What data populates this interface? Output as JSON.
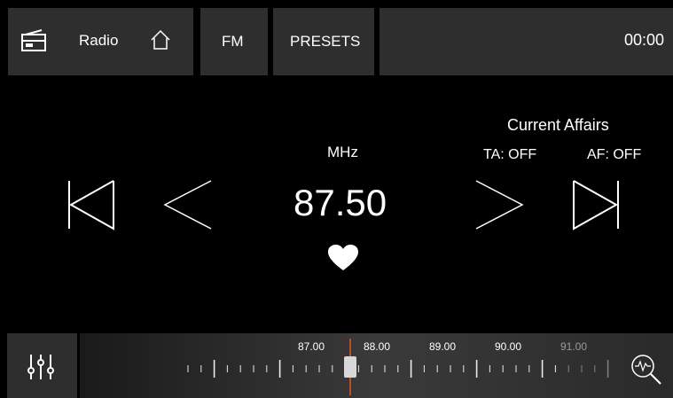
{
  "header": {
    "radio_label": "Radio",
    "band_label": "FM",
    "presets_label": "PRESETS",
    "clock": "00:00"
  },
  "main": {
    "unit": "MHz",
    "frequency": "87.50",
    "station": "Current Affairs",
    "ta": "TA: OFF",
    "af": "AF: OFF",
    "favorite": true
  },
  "tuner": {
    "labels": [
      "87.00",
      "88.00",
      "89.00",
      "90.00",
      "91.00"
    ],
    "current_frequency": 87.5,
    "accent": "#e05a1e"
  },
  "colors": {
    "tile": "#2e2e2e",
    "background": "#000000",
    "text": "#ffffff"
  },
  "icons": [
    "radio-icon",
    "home-icon",
    "skip-back-icon",
    "prev-icon",
    "next-icon",
    "skip-forward-icon",
    "heart-icon",
    "equalizer-icon",
    "search-icon"
  ]
}
